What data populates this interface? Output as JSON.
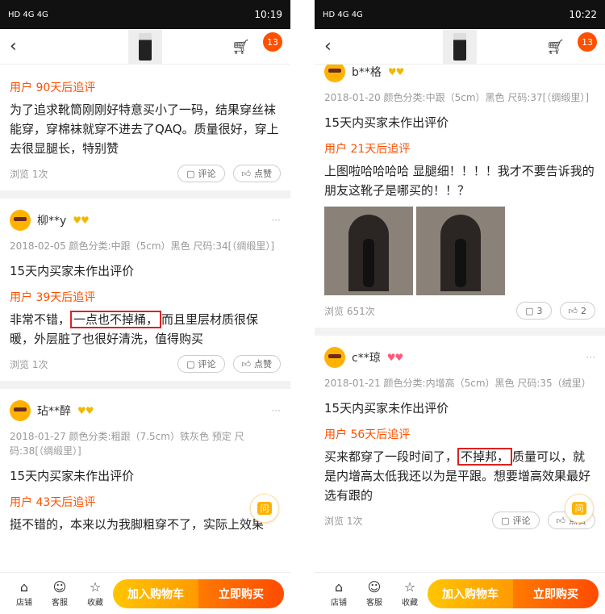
{
  "left": {
    "status": {
      "net": "HD 4G 4G",
      "time": "10:19"
    },
    "badge": "13",
    "reviews": [
      {
        "followup_label": "用户 90天后追评",
        "followup_text": "为了追求靴筒刚刚好特意买小了一码，结果穿丝袜能穿，穿棉袜就穿不进去了QAQ。质量很好，穿上去很显腿长，特别赞",
        "views": "浏览 1次",
        "comment": "评论",
        "like": "点赞"
      },
      {
        "user": "柳**y",
        "meta": "2018-02-05 颜色分类:中跟（5cm）黑色 尺码:34[（绸缎里）]",
        "text": "15天内买家未作出评价",
        "followup_label": "用户 39天后追评",
        "followup_pre": "非常不错，",
        "followup_hl": "一点也不掉桶，",
        "followup_post": "而且里层材质很保暖，外层脏了也很好清洗，值得购买",
        "views": "浏览 1次",
        "comment": "评论",
        "like": "点赞"
      },
      {
        "user": "玷**醉",
        "meta": "2018-01-27 颜色分类:粗跟（7.5cm）铁灰色 预定 尺码:38[（绸缎里）]",
        "text": "15天内买家未作出评价",
        "followup_label": "用户 43天后追评",
        "followup_text": "挺不错的，本来以为我脚粗穿不了，实际上效果"
      }
    ]
  },
  "right": {
    "status": {
      "net": "HD 4G 4G",
      "time": "10:22"
    },
    "badge": "13",
    "reviews": [
      {
        "user": "b**格",
        "meta": "2018-01-20 颜色分类:中跟（5cm）黑色 尺码:37[（绸缎里）]",
        "text": "15天内买家未作出评价",
        "followup_label": "用户 21天后追评",
        "followup_text": "上图啦哈哈哈哈 显腿细！！！！我才不要告诉我的朋友这靴子是哪买的！！？",
        "views": "浏览 651次",
        "comment": "3",
        "like": "2"
      },
      {
        "user": "c**琼",
        "meta": "2018-01-21 颜色分类:内增高（5cm）黑色 尺码:35（绒里）",
        "text": "15天内买家未作出评价",
        "followup_label": "用户 56天后追评",
        "followup_pre": "买来都穿了一段时间了，",
        "followup_hl": "不掉邦，",
        "followup_post": "质量可以，就是内增高太低我还以为是平跟。想要增高效果最好选有跟的",
        "views": "浏览 1次",
        "comment": "评论",
        "like": "点赞"
      }
    ]
  },
  "bottom": {
    "shop": "店铺",
    "service": "客服",
    "fav": "收藏",
    "add_cart": "加入购物车",
    "buy_now": "立即购买"
  },
  "ask": "问",
  "icons": {
    "back": "back-icon",
    "cart": "cart-icon",
    "comment": "comment-icon",
    "like": "thumbs-up-icon"
  },
  "colors": {
    "accent": "#ff5000",
    "highlight_box": "#e02020"
  }
}
